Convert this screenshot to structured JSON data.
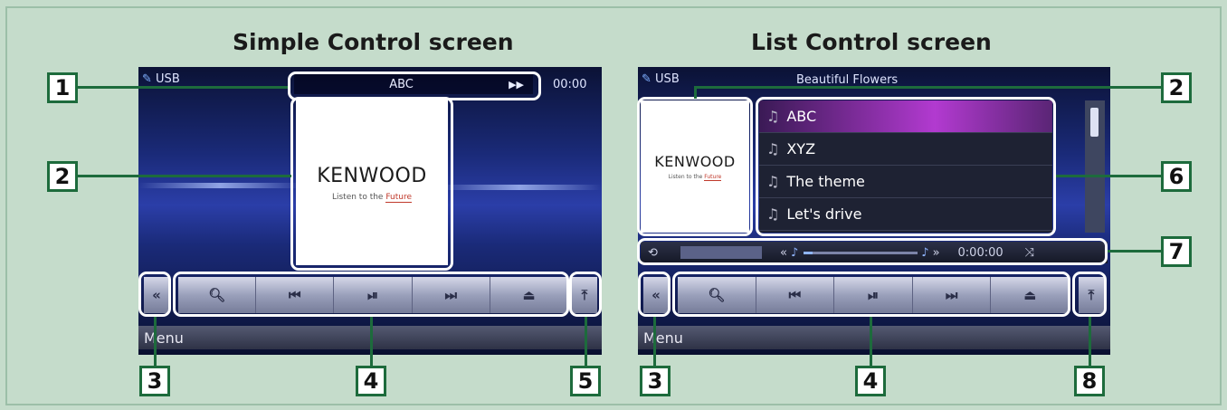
{
  "titles": {
    "simple": "Simple Control screen",
    "list": "List Control screen"
  },
  "simple": {
    "source_label": "USB",
    "track_title": "ABC",
    "play_state_icon": "fast-forward-icon",
    "time": "00:00",
    "brand": "KENWOOD",
    "tagline_start": "Listen to the ",
    "tagline_end": "Future",
    "menu_label": "Menu",
    "side_left_icon": "double-chevron-left-icon",
    "side_right_icon": "upload-arrow-icon",
    "controls": [
      {
        "icon": "search-icon",
        "glyph": "🔍︎"
      },
      {
        "icon": "previous-track-icon",
        "glyph": "⏮"
      },
      {
        "icon": "play-pause-icon",
        "glyph": "⏯"
      },
      {
        "icon": "next-track-icon",
        "glyph": "⏭"
      },
      {
        "icon": "eject-icon",
        "glyph": "⏏"
      }
    ]
  },
  "list": {
    "source_label": "USB",
    "track_title": "Beautiful Flowers",
    "brand": "KENWOOD",
    "tagline_start": "Listen to the ",
    "tagline_end": "Future",
    "items": [
      "ABC",
      "XYZ",
      "The theme",
      "Let's drive"
    ],
    "selected_index": 0,
    "progress_time": "0:00:00",
    "progress_fraction": 0.08,
    "menu_label": "Menu"
  },
  "callouts": {
    "c1": "1",
    "c2a": "2",
    "c3a": "3",
    "c4a": "4",
    "c5": "5",
    "c2b": "2",
    "c6": "6",
    "c7": "7",
    "c3b": "3",
    "c4b": "4",
    "c8": "8"
  },
  "colors": {
    "background": "#c5dccb",
    "callout_border": "#1d6b3c",
    "selection": "#b23ad0"
  }
}
